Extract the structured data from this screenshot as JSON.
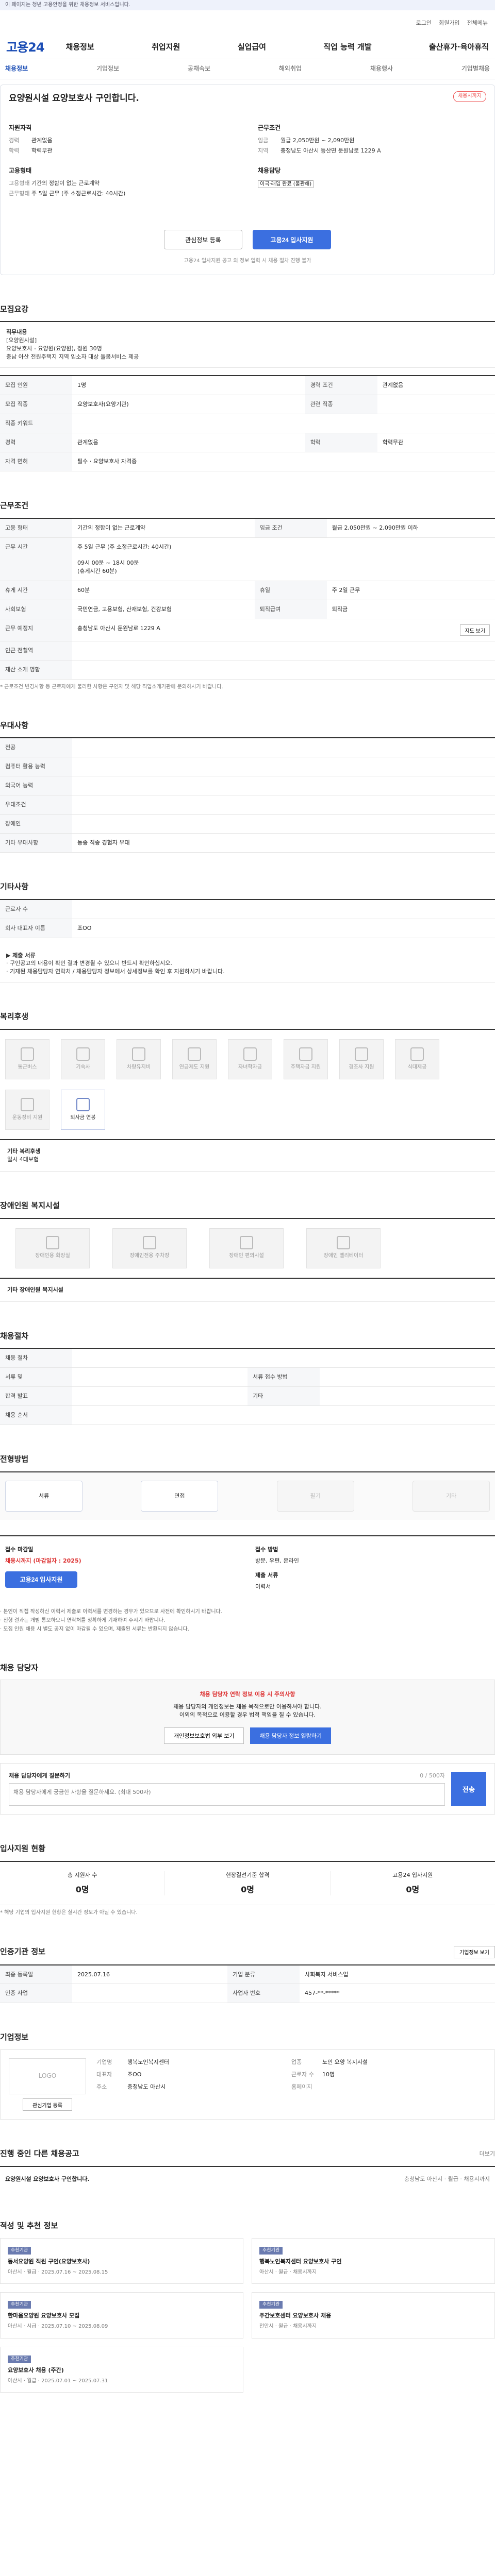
{
  "notice": "이 페이지는 청년 고용안정을 위한 채용정보 서비스입니다.",
  "topbar": {
    "login": "로그인",
    "join": "회원가입",
    "menu": "전체메뉴"
  },
  "brand": {
    "logo": "고용24"
  },
  "gnb": [
    "채용정보",
    "취업지원",
    "실업급여",
    "직업 능력 개발",
    "출산휴가·육아휴직"
  ],
  "lnb": {
    "items": [
      "채용정보",
      "기업정보",
      "공채속보",
      "해외취업",
      "채용행사",
      "기업별채용"
    ],
    "active": 0
  },
  "job": {
    "title": "요양원시설 요양보호사 구인합니다.",
    "deadline_badge": "채용시까지",
    "apply_section": "지원자격",
    "apply_rows": [
      {
        "k": "경력",
        "v": "관계없음"
      },
      {
        "k": "학력",
        "v": "학력무관"
      }
    ],
    "cond_section": "근무조건",
    "cond_rows": [
      {
        "k": "임금",
        "v": "월급 2,050만원 ~ 2,090만원"
      },
      {
        "k": "지역",
        "v": "충청남도 아산시 등산면 둔원남로 1229 A"
      }
    ],
    "emp_section": "고용형태",
    "emp_rows": [
      {
        "k": "고용형태",
        "v": "기간의 정함이 없는 근로계약"
      },
      {
        "k": "근무형태",
        "v": "주 5일 근무 (주 소정근로시간: 40시간)"
      }
    ],
    "etc_section": "채용담당",
    "etc_tag": "이국·래입 완료 (불관해)",
    "btn_scrap": "관심정보 등록",
    "btn_apply": "고용24 입사지원",
    "card_note": "고용24 입사지원 공고 외 정보 입력 시 채용 절차 진행 불가"
  },
  "recruit": {
    "title": "모집요강",
    "desc_label": "직무내용",
    "desc": "[요양원시설]\n요양보호사 - 요양원(요양원), 정원 30명\n충남 아산 전원주택지 지역 입소자 대상 돌봄서비스 제공",
    "rows": [
      {
        "k1": "모집 인원",
        "v1": "1명",
        "k2": "경력 조건",
        "v2": "관계없음"
      },
      {
        "k1": "모집 직종",
        "v1": "요양보호사(요양기관)",
        "k2": "관련 직종",
        "v2": ""
      },
      {
        "k1": "직종 키워드",
        "v1": "",
        "k2": "",
        "v2": ""
      },
      {
        "k1": "경력",
        "v1": "관계없음",
        "k2": "학력",
        "v2": "학력무관"
      },
      {
        "k1": "자격 면허",
        "v1": "필수 · 요양보호사 자격증",
        "k2": "",
        "v2": ""
      }
    ]
  },
  "work": {
    "title": "근무조건",
    "rows": [
      {
        "k1": "고용 형태",
        "v1": "기간의 정함이 없는 근로계약",
        "k2": "임금 조건",
        "v2": "월급 2,050만원 ~ 2,090만원 이하"
      },
      {
        "k1": "근무 시간",
        "v1": "주 5일 근무 (주 소정근로시간: 40시간)\n\n09시 00분 ~ 18시 00분\n(휴게시간 60분)",
        "k2": "",
        "v2": ""
      },
      {
        "k1": "휴게 시간",
        "v1": "60분",
        "k2": "휴일",
        "v2": "주 2일 근무"
      },
      {
        "k1": "사회보험",
        "v1": "국민연금, 고용보험, 산재보험, 건강보험",
        "k2": "퇴직급여",
        "v2": "퇴직금"
      },
      {
        "k1": "근무 예정지",
        "v1": "충청남도 아산시 둔원남로 1229 A",
        "k2": "",
        "v2": ""
      },
      {
        "k1": "인근 전철역",
        "v1": "",
        "k2": "",
        "v2": ""
      },
      {
        "k1": "재산 소개 명함",
        "v1": "",
        "k2": "",
        "v2": ""
      }
    ],
    "map_button": "지도 보기",
    "note": "* 근로조건 변경사항 등 근로자에게 불리한 사항은 구인자 및 해당 직업소개기관에 문의하시기 바랍니다."
  },
  "prefer": {
    "title": "우대사항",
    "rows": [
      {
        "k": "전공",
        "v": ""
      },
      {
        "k": "컴퓨터 활용 능력",
        "v": ""
      },
      {
        "k": "외국어 능력",
        "v": ""
      },
      {
        "k": "우대조건",
        "v": ""
      },
      {
        "k": "장애인",
        "v": ""
      },
      {
        "k": "기타 우대사항",
        "v": "동종 직종 경험자 우대"
      }
    ]
  },
  "others": {
    "title": "기타사항",
    "rows": [
      {
        "k": "근로자 수",
        "v": ""
      },
      {
        "k": "회사 대표자 이름",
        "v": "조OO"
      }
    ],
    "apply_docs_label": "▶ 제출 서류",
    "apply_docs": "· 구인공고의 내용이 확인 결과 변경될 수 있으니 반드시 확인하십시오.\n· 기재된 채용담당자 연락처 / 채용담당자 정보에서 상세정보를 확인 후 지원하시기 바랍니다."
  },
  "welfare": {
    "title": "복리후생",
    "items": [
      {
        "name": "통근버스",
        "on": false
      },
      {
        "name": "기숙사",
        "on": false
      },
      {
        "name": "차량유지비",
        "on": false
      },
      {
        "name": "연금제도 지원",
        "on": false
      },
      {
        "name": "자녀학자금",
        "on": false
      },
      {
        "name": "주택자금 지원",
        "on": false
      },
      {
        "name": "경조사 지원",
        "on": false
      },
      {
        "name": "식대제공",
        "on": false
      },
      {
        "name": "운동장비 지원",
        "on": false
      },
      {
        "name": "퇴사금 연봉",
        "on": true
      }
    ],
    "extra_label": "기타 복리후생",
    "extra": "일시 4대보험"
  },
  "disability": {
    "title": "장애인원 복지시설",
    "items": [
      "장애인용 화장실",
      "장애인전용 주차장",
      "장애인 편의시설",
      "장애인 엘리베이터"
    ],
    "extra_label": "기타 장애인원 복지시설",
    "extra": ""
  },
  "process": {
    "title": "채용절차",
    "rows": [
      {
        "k": "채용 절차",
        "v": ""
      },
      {
        "k": "서류 및",
        "v": "",
        "k2": "서류 접수 방법",
        "v2": ""
      },
      {
        "k": "합격 발표",
        "v": "",
        "k2": "기타",
        "v2": ""
      },
      {
        "k": "채용 순서",
        "v": "",
        "k2": "",
        "v2": ""
      }
    ]
  },
  "steps": {
    "title": "전형방법",
    "items": [
      {
        "name": "서류",
        "on": true
      },
      {
        "name": "면접",
        "on": true
      },
      {
        "name": "필기",
        "on": false
      },
      {
        "name": "기타",
        "on": false
      }
    ]
  },
  "applyinfo": {
    "col1_label": "접수 마감일",
    "col1_value": "채용시까지 (마감일자 : 2025)",
    "col1_btn": "고용24 입사지원",
    "col2_label": "접수 방법",
    "col2_value": "방문, 우편, 온라인",
    "col3_label": "제출 서류",
    "col3_value": "이력서",
    "notes": "· 본인이 직접 작성하신 이력서 제출로 이력서를 변경하는 경우가 있으므로 사전에 확인하시기 바랍니다.\n· 전형 결과는 개별 통보하오니 연락처를 정확하게 기재하여 주시기 바랍니다.\n· 모집 인원 채용 시 별도 공지 없이 마감될 수 있으며, 제출된 서류는 반환되지 않습니다."
  },
  "contact": {
    "title": "채용 담당자",
    "warn_title": "채용 담당자 연락 정보 이용 시 주의사항",
    "warn_text": "채용 담당자의 개인정보는 채용 목적으로만 이용하셔야 합니다.\n이외의 목적으로 이용할 경우 법적 책임을 질 수 있습니다.",
    "btn1": "개인정보보호법 외부 보기",
    "btn2": "채용 담당자 정보 열람하기",
    "qna_label": "채용 담당자에게 질문하기",
    "qna_placeholder": "채용 담당자에게 궁금한 사항을 질문하세요. (최대 500자)",
    "qna_count": "0 / 500자",
    "qna_btn": "전송"
  },
  "stats": {
    "title": "입사지원 현황",
    "items": [
      {
        "label": "총 지원자 수",
        "value": "0명"
      },
      {
        "label": "현장결선기준 합격",
        "value": "0명"
      },
      {
        "label": "고용24 입사지원",
        "value": "0명"
      }
    ],
    "note": "* 해당 기업의 입사지원 현황은 실시간 정보가 아닐 수 있습니다."
  },
  "reginfo": {
    "title": "인증기관 정보",
    "btn": "기업정보 보기",
    "rows": [
      {
        "k1": "최종 등록일",
        "v1": "2025.07.16",
        "k2": "기업 분류",
        "v2": "사회복지 서비스업"
      },
      {
        "k1": "인증 사업",
        "v1": "",
        "k2": "사업자 번호",
        "v2": "457-**-*****"
      }
    ]
  },
  "company": {
    "title": "기업정보",
    "logo": "LOGO",
    "btn": "관심기업 등록",
    "fields": [
      {
        "k": "기업명",
        "v": "행복노인복지센터"
      },
      {
        "k": "업종",
        "v": "노인 요양 복지시설"
      },
      {
        "k": "대표자",
        "v": "조OO"
      },
      {
        "k": "근로자 수",
        "v": "10명"
      },
      {
        "k": "주소",
        "v": "충청남도 아산시"
      },
      {
        "k": "홈페이지",
        "v": ""
      }
    ]
  },
  "otherjobs": {
    "title": "진행 중인 다른 채용공고",
    "more": "더보기",
    "item_title": "요양원시설 요양보호사 구인합니다.",
    "item_meta": "충청남도 아산시 · 월급 · 채용시까지"
  },
  "recommend": {
    "title": "적성 및 추천 정보",
    "items": [
      {
        "badge": "추천기관",
        "title": "동서요양원 직원 구인(요양보호사)",
        "meta": "아산시 · 월급 · 2025.07.16 ~ 2025.08.15"
      },
      {
        "badge": "추천기관",
        "title": "행복노인복지센터 요양보호사 구인",
        "meta": "아산시 · 월급 · 채용시까지"
      },
      {
        "badge": "추천기관",
        "title": "한마음요양원 요양보호사 모집",
        "meta": "아산시 · 시급 · 2025.07.10 ~ 2025.08.09"
      },
      {
        "badge": "추천기관",
        "title": "주간보호센터 요양보호사 채용",
        "meta": "천안시 · 월급 · 채용시까지"
      },
      {
        "badge": "추천기관",
        "title": "요양보호사 채용 (주간)",
        "meta": "아산시 · 월급 · 2025.07.01 ~ 2025.07.31"
      }
    ]
  }
}
